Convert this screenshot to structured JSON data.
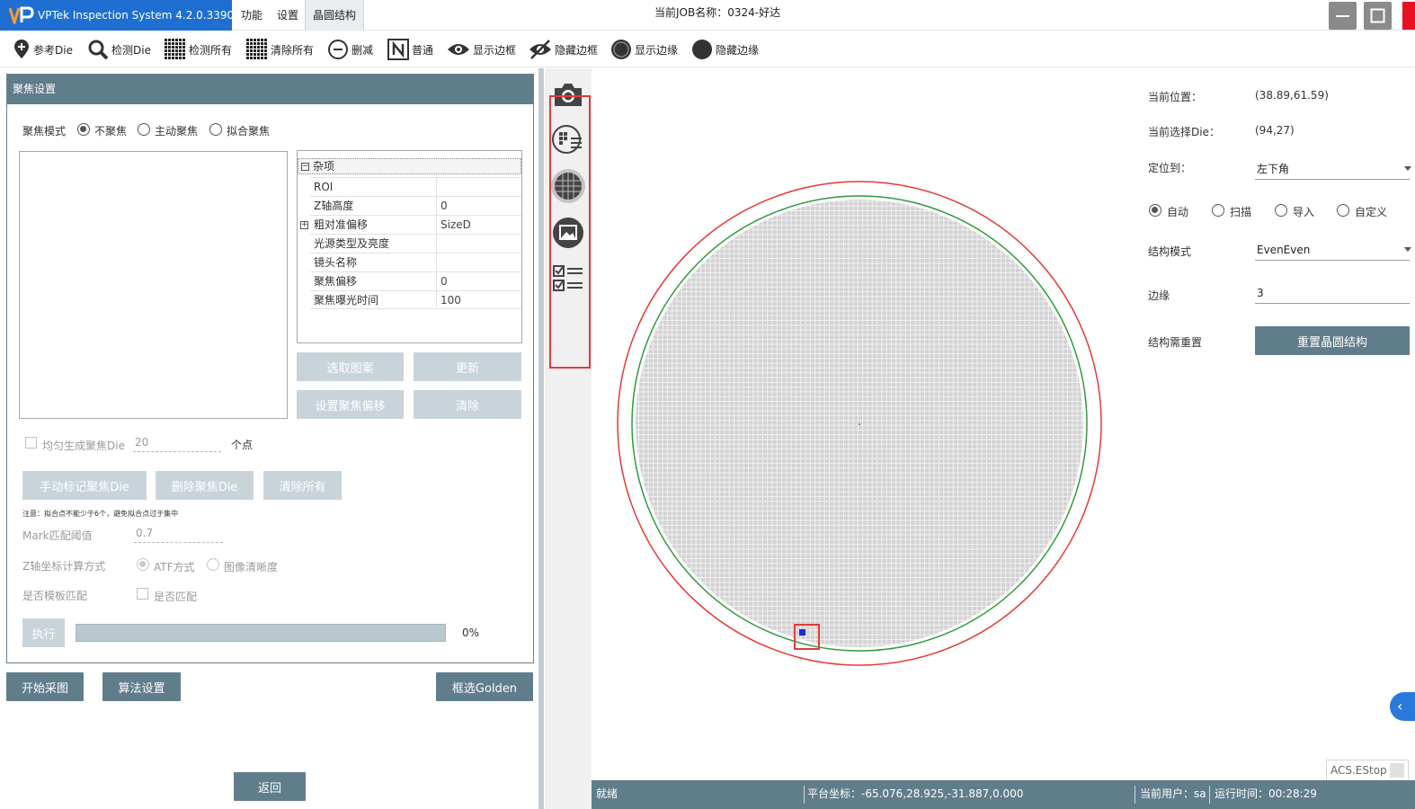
{
  "titlebar": {
    "app_title": "VPTek Inspection System 4.2.0.3390",
    "menu": [
      "功能",
      "设置",
      "晶圆结构"
    ],
    "job_title": "当前JOB名称：0324-好达"
  },
  "toolbar": {
    "items": [
      {
        "label": "参考Die",
        "icon": "pin-plus-icon"
      },
      {
        "label": "检测Die",
        "icon": "magnifier-icon"
      },
      {
        "label": "检测所有",
        "icon": "grid-icon"
      },
      {
        "label": "清除所有",
        "icon": "grid-icon"
      },
      {
        "label": "删减",
        "icon": "minus-circle-icon"
      },
      {
        "label": "普通",
        "icon": "n-box-icon"
      },
      {
        "label": "显示边框",
        "icon": "eye-icon"
      },
      {
        "label": "隐藏边框",
        "icon": "eye-off-icon"
      },
      {
        "label": "显示边缘",
        "icon": "ring-icon"
      },
      {
        "label": "隐藏边缘",
        "icon": "dot-icon"
      }
    ]
  },
  "focus_panel": {
    "header": "聚焦设置",
    "mode_label": "聚焦模式",
    "modes": [
      "不聚焦",
      "主动聚焦",
      "拟合聚焦"
    ],
    "selected_mode": 0,
    "property_grid": {
      "category": "杂项",
      "rows": [
        {
          "key": "ROI",
          "value": ""
        },
        {
          "key": "Z轴高度",
          "value": "0"
        },
        {
          "key": "粗对准偏移",
          "value": "SizeD",
          "expandable": true
        },
        {
          "key": "光源类型及亮度",
          "value": ""
        },
        {
          "key": "镜头名称",
          "value": ""
        },
        {
          "key": "聚焦偏移",
          "value": "0"
        },
        {
          "key": "聚焦曝光时间",
          "value": "100"
        }
      ]
    },
    "btn_select_pattern": "选取图案",
    "btn_update": "更新",
    "btn_set_offset": "设置聚焦偏移",
    "btn_clear": "清除",
    "uniform_label": "均匀生成聚焦Die",
    "uniform_value": "20",
    "uniform_unit": "个点",
    "btn_manual_mark": "手动标记聚焦Die",
    "btn_delete_die": "删除聚焦Die",
    "btn_clear_all": "清除所有",
    "note": "注意：拟合点不能少于6个，避免拟合点过于集中",
    "mark_label": "Mark匹配阈值",
    "mark_value": "0.7",
    "z_calc_label": "Z轴坐标计算方式",
    "z_calc_options": [
      "ATF方式",
      "图像清晰度"
    ],
    "template_label": "是否模板匹配",
    "template_check_label": "是否匹配",
    "btn_execute": "执行",
    "progress": 0,
    "progress_text": "0%"
  },
  "bottom_buttons": {
    "start": "开始采图",
    "algo": "算法设置",
    "golden": "框选Golden",
    "back": "返回"
  },
  "vstrip": {
    "icons": [
      "camera-icon",
      "wafer-list-icon",
      "wafer-grid-icon",
      "image-frame-icon",
      "checklist-icon"
    ]
  },
  "right_panel": {
    "pos_label": "当前位置：",
    "pos_value": "(38.89,61.59)",
    "die_label": "当前选择Die：",
    "die_value": "(94,27)",
    "locate_label": "定位到：",
    "locate_value": "左下角",
    "modes": [
      "自动",
      "扫描",
      "导入",
      "自定义"
    ],
    "selected_mode": 0,
    "struct_label": "结构模式",
    "struct_value": "EvenEven",
    "edge_label": "边缘",
    "edge_value": "3",
    "reset_label": "结构需重置",
    "reset_button": "重置晶圆结构"
  },
  "statusbar": {
    "status": "就绪",
    "coord": "平台坐标：-65.076,28.925,-31.887,0.000",
    "user": "当前用户：sa",
    "runtime": "运行时间：00:28:29"
  },
  "estop": "ACS.EStop",
  "colors": {
    "accent": "#607d8b",
    "title_blue": "#1e6fd1",
    "wafer_outer": "#e53935",
    "wafer_inner": "#2e9b3c",
    "die_fill": "#d3d3d3",
    "highlight": "#e53935"
  }
}
